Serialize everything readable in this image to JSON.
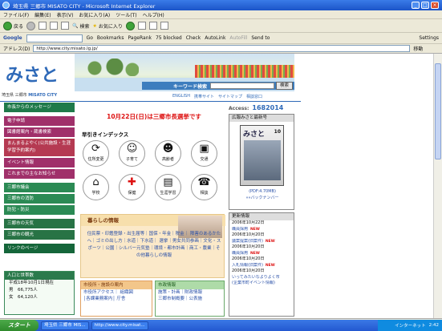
{
  "window": {
    "title": "埼玉県 三郷市 MISATO CITY - Microsoft Internet Explorer"
  },
  "menu": [
    "ファイル(F)",
    "編集(E)",
    "表示(V)",
    "お気に入り(A)",
    "ツール(T)",
    "ヘルプ(H)"
  ],
  "toolbar": {
    "back": "戻る",
    "search": "検索",
    "favorites": "お気に入り"
  },
  "google_bar": {
    "label": "Google",
    "go": "Go",
    "bookmarks": "Bookmarks",
    "pagerank": "PageRank",
    "blocked": "75 blocked",
    "check": "Check",
    "autolink": "AutoLink",
    "autofill": "AutoFill",
    "sendto": "Send to",
    "settings": "Settings"
  },
  "address": {
    "label": "アドレス(D)",
    "url": "http://www.city.misato.lg.jp/",
    "go": "移動"
  },
  "page": {
    "logo": "みさと",
    "city_jp": "埼玉県 三郷市",
    "city_en": "MISATO CITY",
    "keyword_label": "キーワード検索",
    "keyword_button": "検索",
    "top_links": [
      "ENGLISH",
      "携帯サイト",
      "サイトマップ",
      "相談窓口"
    ],
    "election": "10月22日(日)は三郷市長選挙です",
    "index_title": "早引きインデックス",
    "access_label": "Access:",
    "access_count": "1682014"
  },
  "nav": [
    {
      "label": "市長からのメッセージ",
      "color": "c-dg"
    },
    {
      "label": "電子申請",
      "color": "c-pk"
    },
    {
      "label": "図書館案内・蔵書検索",
      "color": "c-pk"
    },
    {
      "label": "まんまるよやく(公共施設・生涯学習予約案内)",
      "color": "c-rd",
      "tall": true
    },
    {
      "label": "イベント情報",
      "color": "c-pk"
    },
    {
      "label": "これまでの主なお知らせ",
      "color": "c-pk"
    },
    {
      "label": "三郷市議会",
      "color": "c-gr"
    },
    {
      "label": "三郷市の消防",
      "color": "c-gr"
    },
    {
      "label": "防犯・防災",
      "color": "c-gr"
    },
    {
      "label": "三郷市の天気",
      "color": "c-gn"
    },
    {
      "label": "三郷市の観光",
      "color": "c-gn"
    },
    {
      "label": "リンクのページ",
      "color": "c-db"
    }
  ],
  "population": {
    "title": "人口と世帯数",
    "date": "平成18年10月1日現在",
    "male_label": "男",
    "male": "66,775人",
    "female_label": "女",
    "female": "64,120人"
  },
  "index_icons": [
    {
      "label": "住所変更",
      "glyph": "⟳"
    },
    {
      "label": "子育て",
      "glyph": "☺"
    },
    {
      "label": "高齢者",
      "glyph": "☻"
    },
    {
      "label": "交通",
      "glyph": "▣"
    },
    {
      "label": "学校",
      "glyph": "⌂"
    },
    {
      "label": "保健",
      "glyph": "✚"
    },
    {
      "label": "生涯学習",
      "glyph": "▤"
    },
    {
      "label": "相談",
      "glyph": "☎"
    }
  ],
  "life": {
    "title": "暮らしの情報",
    "links": "住民票・印鑑登録・出生届等｜国保・年金｜税金｜ 障害のあるかたへ｜ゴミの出し方｜水道｜下水道｜ 選挙｜男女共同参画｜文化・スポーツ｜公園｜シルバー元気塾｜環境・都市計画｜商工・農業｜その他暮らしの情報"
  },
  "gov": {
    "title": "市役所・施設の案内",
    "l1": "市役所アクセス｜ 組織図",
    "l2": "│各課業務案内│ 庁舎"
  },
  "biz": {
    "title": "市政情報",
    "l1": "施策・計画｜財政情報",
    "l2": "三郷市制概要｜公表施"
  },
  "koho": {
    "title": "広報みさと最新号",
    "cover": "みさと",
    "issue": "10",
    "pdf": "(PDF:4.70MB)",
    "back": "»»バックナンバー"
  },
  "updates": {
    "title": "更新情報",
    "items": [
      {
        "text": "2006年10月22日",
        "kind": "date"
      },
      {
        "text": "職員採用",
        "kind": "link",
        "new": true
      },
      {
        "text": "2006年10月20日",
        "kind": "date"
      },
      {
        "text": "議案提案(旧案件)",
        "kind": "link",
        "new": true
      },
      {
        "text": "2006年10月20日",
        "kind": "date"
      },
      {
        "text": "職員採用",
        "kind": "link",
        "new": true
      },
      {
        "text": "2006年10月20日",
        "kind": "date"
      },
      {
        "text": "入札情報(旧案件)",
        "kind": "link",
        "new": true
      },
      {
        "text": "2006年10月20日",
        "kind": "date"
      },
      {
        "text": "いってみたいなよりよく市",
        "kind": "link"
      },
      {
        "text": "(企業市町イベント情報)",
        "kind": "link"
      }
    ]
  },
  "new_label": "NEW",
  "taskbar": {
    "start": "スタート",
    "tasks": [
      "埼玉県 三郷市 MIS...",
      "http://www.city.misat..."
    ],
    "tray_text": "インターネット",
    "clock": "2:42"
  }
}
